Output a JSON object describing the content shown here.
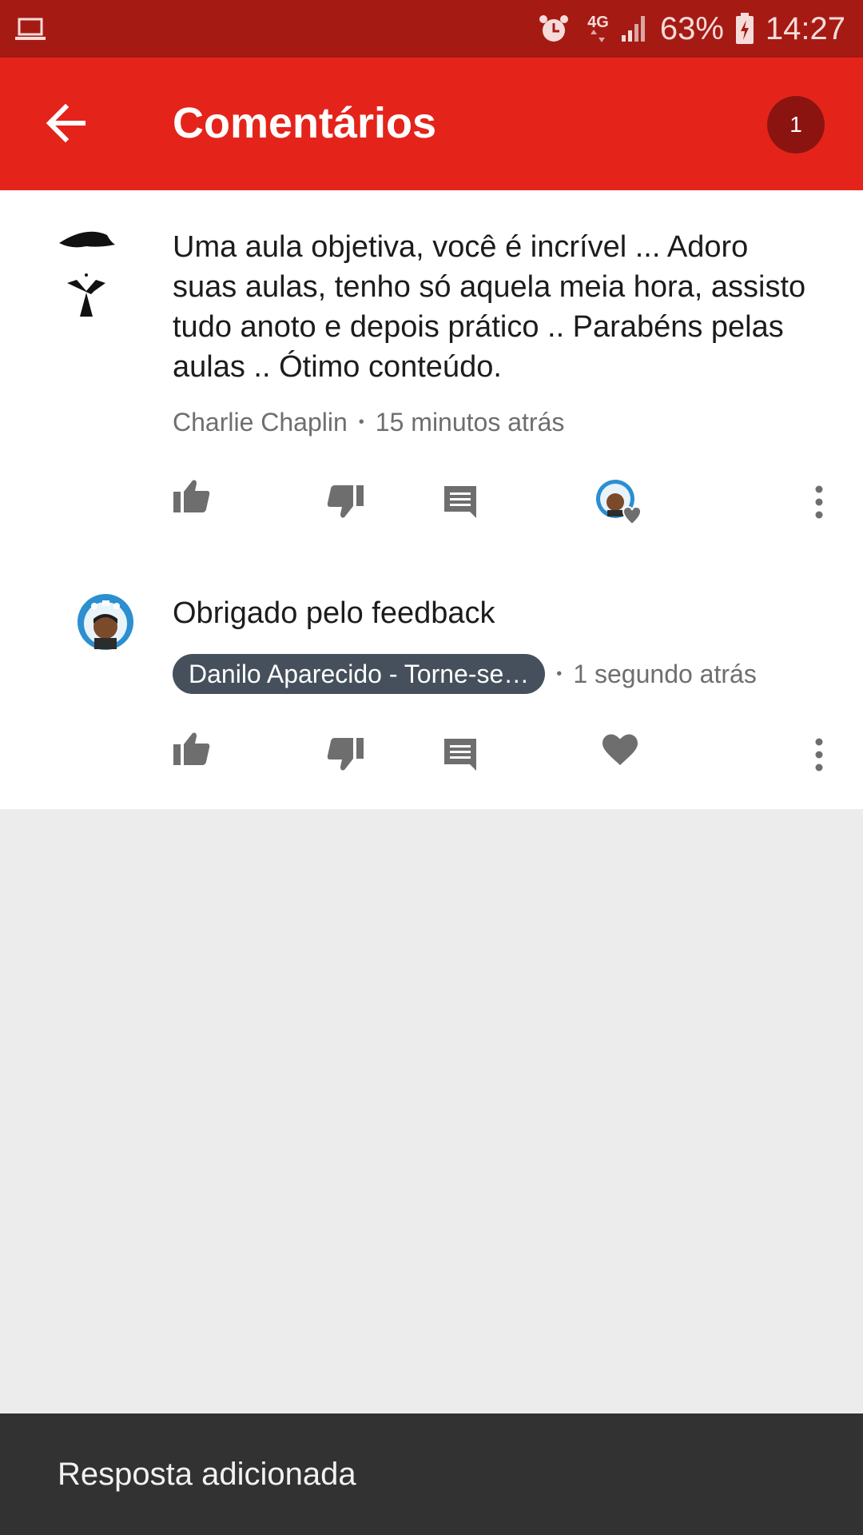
{
  "status_bar": {
    "left_icon": "laptop-icon",
    "alarm_icon": "alarm-icon",
    "network": "4G",
    "signal_icon": "signal-icon",
    "battery": "63%",
    "battery_icon": "battery-charging-icon",
    "time": "14:27"
  },
  "app_bar": {
    "back_icon": "arrow-back-icon",
    "title": "Comentários",
    "count": "1",
    "color": "#e4241b"
  },
  "comments": [
    {
      "avatar": "chaplin-avatar",
      "text": "Uma aula objetiva, você é incrível ... Adoro suas aulas, tenho só aquela meia hora, assisto tudo anoto e depois prático .. Parabéns pelas aulas .. Ótimo conteúdo.",
      "author": "Charlie Chaplin",
      "separator": "•",
      "time": "15 minutos atrás",
      "actions": [
        "like-icon",
        "dislike-icon",
        "reply-icon",
        "creator-heart-icon",
        "more-vert-icon"
      ]
    },
    {
      "avatar": "danilo-avatar",
      "text": "Obrigado pelo feedback",
      "author": "Danilo Aparecido - Torne-se…",
      "separator": "•",
      "time": "1 segundo atrás",
      "actions": [
        "like-icon",
        "dislike-icon",
        "reply-icon",
        "heart-icon",
        "more-vert-icon"
      ]
    }
  ],
  "snackbar": {
    "message": "Resposta adicionada"
  }
}
